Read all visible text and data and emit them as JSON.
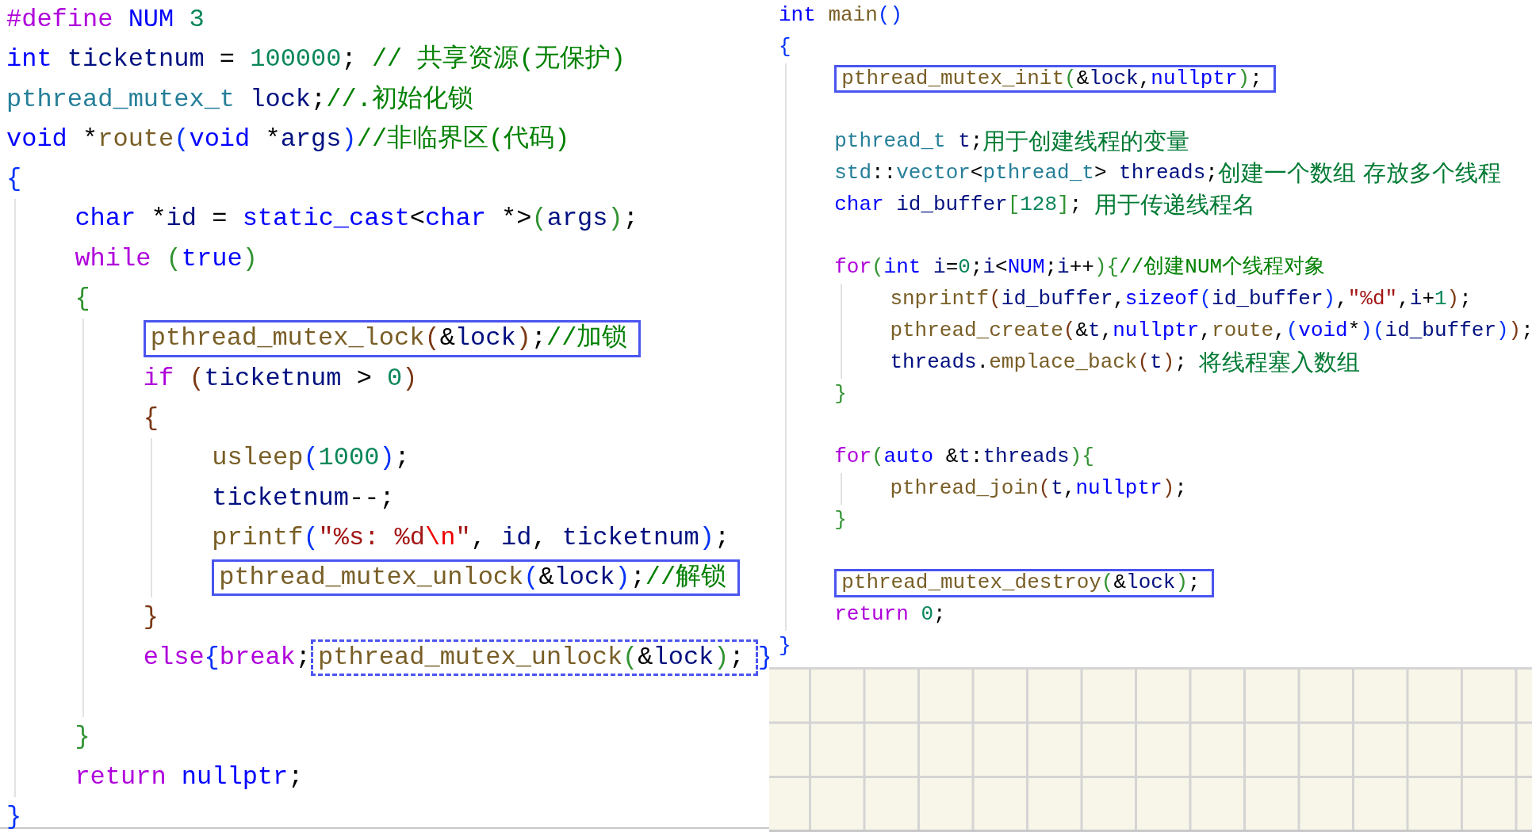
{
  "left_code": {
    "lines": [
      {
        "kind": "code",
        "tokens": [
          {
            "text": "#define",
            "kind": "keyword"
          },
          {
            "text": " NUM",
            "kind": "macro"
          },
          {
            "text": " 3",
            "kind": "number"
          }
        ]
      },
      {
        "kind": "code",
        "tokens": [
          {
            "text": "int",
            "kind": "type"
          },
          {
            "text": " ticketnum",
            "kind": "variable"
          },
          {
            "text": " = ",
            "kind": "plain"
          },
          {
            "text": "100000",
            "kind": "number"
          },
          {
            "text": "; ",
            "kind": "plain"
          },
          {
            "text": "// 共享资源(无保护)",
            "kind": "comment"
          }
        ]
      },
      {
        "kind": "code",
        "tokens": [
          {
            "text": "pthread_mutex_t",
            "kind": "class"
          },
          {
            "text": " lock",
            "kind": "variable"
          },
          {
            "text": ";",
            "kind": "plain"
          },
          {
            "text": "//.初始化锁",
            "kind": "comment"
          }
        ]
      },
      {
        "kind": "code",
        "tokens": [
          {
            "text": "void",
            "kind": "type"
          },
          {
            "text": " *",
            "kind": "plain"
          },
          {
            "text": "route",
            "kind": "function"
          },
          {
            "text": "(",
            "kind": "bracket1"
          },
          {
            "text": "void",
            "kind": "type"
          },
          {
            "text": " *",
            "kind": "plain"
          },
          {
            "text": "args",
            "kind": "variable"
          },
          {
            "text": ")",
            "kind": "bracket1"
          },
          {
            "text": "//非临界区(代码)",
            "kind": "comment"
          }
        ]
      },
      {
        "kind": "code",
        "tokens": [
          {
            "text": "{",
            "kind": "bracket1"
          }
        ],
        "children": [
          {
            "kind": "code",
            "tokens": [
              {
                "text": "char",
                "kind": "type"
              },
              {
                "text": " *",
                "kind": "plain"
              },
              {
                "text": "id",
                "kind": "variable"
              },
              {
                "text": " = ",
                "kind": "plain"
              },
              {
                "text": "static_cast",
                "kind": "type"
              },
              {
                "text": "<",
                "kind": "plain"
              },
              {
                "text": "char",
                "kind": "type"
              },
              {
                "text": " *>",
                "kind": "plain"
              },
              {
                "text": "(",
                "kind": "bracket2"
              },
              {
                "text": "args",
                "kind": "variable"
              },
              {
                "text": ")",
                "kind": "bracket2"
              },
              {
                "text": ";",
                "kind": "plain"
              }
            ]
          },
          {
            "kind": "code",
            "tokens": [
              {
                "text": "while",
                "kind": "keyword"
              },
              {
                "text": " (",
                "kind": "bracket2"
              },
              {
                "text": "true",
                "kind": "type"
              },
              {
                "text": ")",
                "kind": "bracket2"
              }
            ]
          },
          {
            "kind": "code",
            "tokens": [
              {
                "text": "{",
                "kind": "bracket2"
              }
            ],
            "children": [
              {
                "kind": "code",
                "tokens": [
                  {
                    "kind": "frame",
                    "dashed": false,
                    "tokens": [
                      {
                        "text": "pthread_mutex_lock",
                        "kind": "function"
                      },
                      {
                        "text": "(",
                        "kind": "bracket3"
                      },
                      {
                        "text": "&",
                        "kind": "plain"
                      },
                      {
                        "text": "lock",
                        "kind": "variable"
                      },
                      {
                        "text": ")",
                        "kind": "bracket3"
                      },
                      {
                        "text": ";",
                        "kind": "plain"
                      },
                      {
                        "text": "//加锁",
                        "kind": "comment"
                      }
                    ]
                  }
                ]
              },
              {
                "kind": "code",
                "tokens": [
                  {
                    "text": "if",
                    "kind": "keyword"
                  },
                  {
                    "text": " (",
                    "kind": "bracket3"
                  },
                  {
                    "text": "ticketnum",
                    "kind": "variable"
                  },
                  {
                    "text": " > ",
                    "kind": "plain"
                  },
                  {
                    "text": "0",
                    "kind": "number"
                  },
                  {
                    "text": ")",
                    "kind": "bracket3"
                  }
                ]
              },
              {
                "kind": "code",
                "tokens": [
                  {
                    "text": "{",
                    "kind": "bracket3"
                  }
                ],
                "children": [
                  {
                    "kind": "code",
                    "tokens": [
                      {
                        "text": "usleep",
                        "kind": "function"
                      },
                      {
                        "text": "(",
                        "kind": "bracket1"
                      },
                      {
                        "text": "1000",
                        "kind": "number"
                      },
                      {
                        "text": ")",
                        "kind": "bracket1"
                      },
                      {
                        "text": ";",
                        "kind": "plain"
                      }
                    ]
                  },
                  {
                    "kind": "code",
                    "tokens": [
                      {
                        "text": "ticketnum",
                        "kind": "variable"
                      },
                      {
                        "text": "--;",
                        "kind": "plain"
                      }
                    ]
                  },
                  {
                    "kind": "code",
                    "tokens": [
                      {
                        "text": "printf",
                        "kind": "function"
                      },
                      {
                        "text": "(",
                        "kind": "bracket1"
                      },
                      {
                        "text": "\"%s: %d",
                        "kind": "string"
                      },
                      {
                        "text": "\\n",
                        "kind": "escape"
                      },
                      {
                        "text": "\"",
                        "kind": "string"
                      },
                      {
                        "text": ", ",
                        "kind": "plain"
                      },
                      {
                        "text": "id",
                        "kind": "variable"
                      },
                      {
                        "text": ", ",
                        "kind": "plain"
                      },
                      {
                        "text": "ticketnum",
                        "kind": "variable"
                      },
                      {
                        "text": ")",
                        "kind": "bracket1"
                      },
                      {
                        "text": ";",
                        "kind": "plain"
                      }
                    ]
                  },
                  {
                    "kind": "code",
                    "tokens": [
                      {
                        "kind": "frame",
                        "dashed": false,
                        "tokens": [
                          {
                            "text": "pthread_mutex_unlock",
                            "kind": "function"
                          },
                          {
                            "text": "(",
                            "kind": "bracket1"
                          },
                          {
                            "text": "&",
                            "kind": "plain"
                          },
                          {
                            "text": "lock",
                            "kind": "variable"
                          },
                          {
                            "text": ")",
                            "kind": "bracket1"
                          },
                          {
                            "text": ";",
                            "kind": "plain"
                          },
                          {
                            "text": "//解锁",
                            "kind": "comment"
                          }
                        ]
                      }
                    ]
                  }
                ]
              },
              {
                "kind": "code",
                "tokens": [
                  {
                    "text": "}",
                    "kind": "bracket3"
                  }
                ]
              },
              {
                "kind": "code",
                "tokens": [
                  {
                    "text": "else",
                    "kind": "keyword"
                  },
                  {
                    "text": "{",
                    "kind": "bracket1"
                  },
                  {
                    "text": "break",
                    "kind": "keyword"
                  },
                  {
                    "text": ";",
                    "kind": "plain"
                  },
                  {
                    "kind": "frame",
                    "dashed": true,
                    "tokens": [
                      {
                        "text": "pthread_mutex_unlock",
                        "kind": "function"
                      },
                      {
                        "text": "(",
                        "kind": "bracket2"
                      },
                      {
                        "text": "&",
                        "kind": "plain"
                      },
                      {
                        "text": "lock",
                        "kind": "variable"
                      },
                      {
                        "text": ")",
                        "kind": "bracket2"
                      },
                      {
                        "text": ";",
                        "kind": "plain"
                      }
                    ]
                  },
                  {
                    "text": "}",
                    "kind": "bracket1"
                  }
                ]
              },
              {
                "kind": "blank"
              }
            ]
          },
          {
            "kind": "code",
            "tokens": [
              {
                "text": "}",
                "kind": "bracket2"
              }
            ]
          },
          {
            "kind": "code",
            "tokens": [
              {
                "text": "return",
                "kind": "keyword"
              },
              {
                "text": " nullptr",
                "kind": "type"
              },
              {
                "text": ";",
                "kind": "plain"
              }
            ]
          }
        ]
      },
      {
        "kind": "code",
        "tokens": [
          {
            "text": "}",
            "kind": "bracket1"
          }
        ]
      }
    ]
  },
  "right_code": {
    "lines": [
      {
        "kind": "code",
        "tokens": [
          {
            "text": "int",
            "kind": "type"
          },
          {
            "text": " main",
            "kind": "function"
          },
          {
            "text": "()",
            "kind": "bracket1"
          }
        ]
      },
      {
        "kind": "code",
        "tokens": [
          {
            "text": "{",
            "kind": "bracket1"
          }
        ],
        "children": [
          {
            "kind": "code",
            "tokens": [
              {
                "kind": "frame",
                "dashed": false,
                "tokens": [
                  {
                    "text": "pthread_mutex_init",
                    "kind": "function"
                  },
                  {
                    "text": "(",
                    "kind": "bracket2"
                  },
                  {
                    "text": "&",
                    "kind": "plain"
                  },
                  {
                    "text": "lock",
                    "kind": "variable"
                  },
                  {
                    "text": ",",
                    "kind": "plain"
                  },
                  {
                    "text": "nullptr",
                    "kind": "type"
                  },
                  {
                    "text": ")",
                    "kind": "bracket2"
                  },
                  {
                    "text": ";",
                    "kind": "plain"
                  }
                ]
              }
            ]
          },
          {
            "kind": "blank"
          },
          {
            "kind": "code",
            "tokens": [
              {
                "text": "pthread_t",
                "kind": "class"
              },
              {
                "text": " t",
                "kind": "variable"
              },
              {
                "text": ";",
                "kind": "plain"
              },
              {
                "text": "用于创建线程的变量",
                "kind": "note"
              }
            ]
          },
          {
            "kind": "code",
            "tokens": [
              {
                "text": "std",
                "kind": "class"
              },
              {
                "text": "::",
                "kind": "plain"
              },
              {
                "text": "vector",
                "kind": "class"
              },
              {
                "text": "<",
                "kind": "plain"
              },
              {
                "text": "pthread_t",
                "kind": "class"
              },
              {
                "text": "> ",
                "kind": "plain"
              },
              {
                "text": "threads",
                "kind": "variable"
              },
              {
                "text": ";",
                "kind": "plain"
              },
              {
                "text": "创建一个数组 存放多个线程",
                "kind": "note"
              }
            ]
          },
          {
            "kind": "code",
            "tokens": [
              {
                "text": "char",
                "kind": "type"
              },
              {
                "text": " id_buffer",
                "kind": "variable"
              },
              {
                "text": "[",
                "kind": "bracket2"
              },
              {
                "text": "128",
                "kind": "number"
              },
              {
                "text": "]",
                "kind": "bracket2"
              },
              {
                "text": "; ",
                "kind": "plain"
              },
              {
                "text": "用于传递线程名",
                "kind": "note"
              }
            ]
          },
          {
            "kind": "blank"
          },
          {
            "kind": "code",
            "tokens": [
              {
                "text": "for",
                "kind": "keyword"
              },
              {
                "text": "(",
                "kind": "bracket2"
              },
              {
                "text": "int",
                "kind": "type"
              },
              {
                "text": " i",
                "kind": "variable"
              },
              {
                "text": "=",
                "kind": "plain"
              },
              {
                "text": "0",
                "kind": "number"
              },
              {
                "text": ";",
                "kind": "plain"
              },
              {
                "text": "i",
                "kind": "variable"
              },
              {
                "text": "<",
                "kind": "plain"
              },
              {
                "text": "NUM",
                "kind": "macro"
              },
              {
                "text": ";",
                "kind": "plain"
              },
              {
                "text": "i",
                "kind": "variable"
              },
              {
                "text": "++",
                "kind": "plain"
              },
              {
                "text": ")",
                "kind": "bracket2"
              },
              {
                "text": "{",
                "kind": "bracket2"
              },
              {
                "text": "//创建NUM个线程对象",
                "kind": "comment"
              }
            ],
            "children": [
              {
                "kind": "code",
                "tokens": [
                  {
                    "text": "snprintf",
                    "kind": "function"
                  },
                  {
                    "text": "(",
                    "kind": "bracket3"
                  },
                  {
                    "text": "id_buffer",
                    "kind": "variable"
                  },
                  {
                    "text": ",",
                    "kind": "plain"
                  },
                  {
                    "text": "sizeof",
                    "kind": "type"
                  },
                  {
                    "text": "(",
                    "kind": "bracket1"
                  },
                  {
                    "text": "id_buffer",
                    "kind": "variable"
                  },
                  {
                    "text": ")",
                    "kind": "bracket1"
                  },
                  {
                    "text": ",",
                    "kind": "plain"
                  },
                  {
                    "text": "\"%d\"",
                    "kind": "string"
                  },
                  {
                    "text": ",",
                    "kind": "plain"
                  },
                  {
                    "text": "i",
                    "kind": "variable"
                  },
                  {
                    "text": "+",
                    "kind": "plain"
                  },
                  {
                    "text": "1",
                    "kind": "number"
                  },
                  {
                    "text": ")",
                    "kind": "bracket3"
                  },
                  {
                    "text": ";",
                    "kind": "plain"
                  }
                ]
              },
              {
                "kind": "code",
                "tokens": [
                  {
                    "text": "pthread_create",
                    "kind": "function"
                  },
                  {
                    "text": "(",
                    "kind": "bracket3"
                  },
                  {
                    "text": "&",
                    "kind": "plain"
                  },
                  {
                    "text": "t",
                    "kind": "variable"
                  },
                  {
                    "text": ",",
                    "kind": "plain"
                  },
                  {
                    "text": "nullptr",
                    "kind": "type"
                  },
                  {
                    "text": ",",
                    "kind": "plain"
                  },
                  {
                    "text": "route",
                    "kind": "function"
                  },
                  {
                    "text": ",",
                    "kind": "plain"
                  },
                  {
                    "text": "(",
                    "kind": "bracket1"
                  },
                  {
                    "text": "void",
                    "kind": "type"
                  },
                  {
                    "text": "*",
                    "kind": "plain"
                  },
                  {
                    "text": ")",
                    "kind": "bracket1"
                  },
                  {
                    "text": "(",
                    "kind": "bracket1"
                  },
                  {
                    "text": "id_buffer",
                    "kind": "variable"
                  },
                  {
                    "text": ")",
                    "kind": "bracket1"
                  },
                  {
                    "text": ")",
                    "kind": "bracket3"
                  },
                  {
                    "text": ";",
                    "kind": "plain"
                  }
                ]
              },
              {
                "kind": "code",
                "tokens": [
                  {
                    "text": "threads",
                    "kind": "variable"
                  },
                  {
                    "text": ".",
                    "kind": "plain"
                  },
                  {
                    "text": "emplace_back",
                    "kind": "function"
                  },
                  {
                    "text": "(",
                    "kind": "bracket3"
                  },
                  {
                    "text": "t",
                    "kind": "variable"
                  },
                  {
                    "text": ")",
                    "kind": "bracket3"
                  },
                  {
                    "text": "; ",
                    "kind": "plain"
                  },
                  {
                    "text": "将线程塞入数组",
                    "kind": "note"
                  }
                ]
              }
            ]
          },
          {
            "kind": "code",
            "tokens": [
              {
                "text": "}",
                "kind": "bracket2"
              }
            ]
          },
          {
            "kind": "blank"
          },
          {
            "kind": "code",
            "tokens": [
              {
                "text": "for",
                "kind": "keyword"
              },
              {
                "text": "(",
                "kind": "bracket2"
              },
              {
                "text": "auto",
                "kind": "type"
              },
              {
                "text": " &",
                "kind": "plain"
              },
              {
                "text": "t",
                "kind": "variable"
              },
              {
                "text": ":",
                "kind": "plain"
              },
              {
                "text": "threads",
                "kind": "variable"
              },
              {
                "text": ")",
                "kind": "bracket2"
              },
              {
                "text": "{",
                "kind": "bracket2"
              }
            ],
            "children": [
              {
                "kind": "code",
                "tokens": [
                  {
                    "text": "pthread_join",
                    "kind": "function"
                  },
                  {
                    "text": "(",
                    "kind": "bracket3"
                  },
                  {
                    "text": "t",
                    "kind": "variable"
                  },
                  {
                    "text": ",",
                    "kind": "plain"
                  },
                  {
                    "text": "nullptr",
                    "kind": "type"
                  },
                  {
                    "text": ")",
                    "kind": "bracket3"
                  },
                  {
                    "text": ";",
                    "kind": "plain"
                  }
                ]
              }
            ]
          },
          {
            "kind": "code",
            "tokens": [
              {
                "text": "}",
                "kind": "bracket2"
              }
            ]
          },
          {
            "kind": "blank"
          },
          {
            "kind": "code",
            "tokens": [
              {
                "kind": "frame",
                "dashed": false,
                "tokens": [
                  {
                    "text": "pthread_mutex_destroy",
                    "kind": "function"
                  },
                  {
                    "text": "(",
                    "kind": "bracket2"
                  },
                  {
                    "text": "&",
                    "kind": "plain"
                  },
                  {
                    "text": "lock",
                    "kind": "variable"
                  },
                  {
                    "text": ")",
                    "kind": "bracket2"
                  },
                  {
                    "text": ";",
                    "kind": "plain"
                  }
                ]
              }
            ]
          },
          {
            "kind": "code",
            "tokens": [
              {
                "text": "return",
                "kind": "keyword"
              },
              {
                "text": " 0",
                "kind": "number"
              },
              {
                "text": ";",
                "kind": "plain"
              }
            ]
          }
        ]
      },
      {
        "kind": "code",
        "tokens": [
          {
            "text": "}",
            "kind": "bracket1"
          }
        ]
      }
    ]
  }
}
